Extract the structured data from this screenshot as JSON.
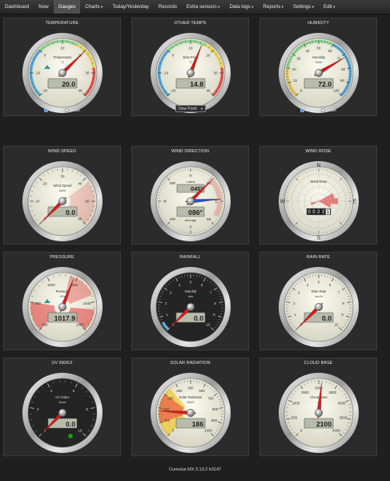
{
  "nav": {
    "items": [
      {
        "label": "Dashboard",
        "caret": ""
      },
      {
        "label": "Now",
        "caret": ""
      },
      {
        "label": "Gauges",
        "caret": ""
      },
      {
        "label": "Charts",
        "caret": "▾"
      },
      {
        "label": "Today/Yesterday",
        "caret": ""
      },
      {
        "label": "Records",
        "caret": ""
      },
      {
        "label": "Extra sensors",
        "caret": "▾"
      },
      {
        "label": "Data logs",
        "caret": "▾"
      },
      {
        "label": "Reports",
        "caret": "▾"
      },
      {
        "label": "Settings",
        "caret": "▾"
      },
      {
        "label": "Edit",
        "caret": "▾"
      }
    ],
    "active_index": 2
  },
  "panels": {
    "temperature": {
      "title": "TEMPERATURE",
      "name": "Temperature",
      "unit": "°C",
      "value": "20.0",
      "ticks": [
        "-20",
        "-10",
        "0",
        "10",
        "20",
        "30",
        "40"
      ],
      "radio": {
        "option1": "Outside",
        "option2": "Inside",
        "selected": "Outside"
      }
    },
    "other_temps": {
      "title": "OTHER TEMPS",
      "name": "Dew Point",
      "unit": "°C",
      "value": "14.8",
      "ticks": [
        "-20",
        "-10",
        "0",
        "10",
        "20",
        "30",
        "40"
      ],
      "select": "Dew Point"
    },
    "humidity": {
      "title": "HUMIDITY",
      "name": "Humidity",
      "unit": "%RH",
      "value": "72.0",
      "ticks": [
        "0",
        "10",
        "20",
        "30",
        "40",
        "50",
        "60",
        "70",
        "80",
        "90",
        "100"
      ],
      "radio": {
        "option1": "Outside",
        "option2": "Inside",
        "selected": "Outside"
      }
    },
    "wind_speed": {
      "title": "WIND SPEED",
      "name": "Wind Speed",
      "unit": "km/h",
      "value": "0.0",
      "ticks": [
        "0",
        "10",
        "20",
        "30",
        "40",
        "50",
        "60"
      ]
    },
    "wind_direction": {
      "title": "WIND DIRECTION",
      "latest_label": "Latest",
      "latest": "045°",
      "average_label": "Average",
      "average": "086°",
      "compass": [
        "N",
        "NE",
        "E",
        "SE",
        "S",
        "SW",
        "W",
        "NW"
      ]
    },
    "wind_rose": {
      "title": "WIND ROSE",
      "name": "Wind Rose",
      "odometer": "00221",
      "compass": [
        "N",
        "E",
        "S",
        "W"
      ]
    },
    "pressure": {
      "title": "PRESSURE",
      "name": "Pressure",
      "unit": "hPa",
      "value": "1017.9",
      "ticks": [
        "960",
        "980",
        "1000",
        "1020",
        "1040",
        "1060"
      ]
    },
    "rainfall": {
      "title": "RAINFALL",
      "name": "Rainfall",
      "unit": "mm",
      "value": "0.0",
      "ticks": [
        "0",
        "1",
        "2",
        "3",
        "4",
        "5",
        "6",
        "7",
        "8",
        "9",
        "10"
      ]
    },
    "rain_rate": {
      "title": "RAIN RATE",
      "name": "Rain Rate",
      "unit": "mm/h",
      "value": "0.0",
      "ticks": [
        "0",
        "1",
        "2",
        "3",
        "4",
        "5",
        "6",
        "7",
        "8",
        "9",
        "10"
      ]
    },
    "uv_index": {
      "title": "UV INDEX",
      "name": "UV Index",
      "unit": "None",
      "value": "0.0",
      "ticks": [
        "0",
        "2",
        "4",
        "6",
        "8",
        "10"
      ]
    },
    "solar_radiation": {
      "title": "SOLAR RADIATION",
      "name": "Solar Radiation",
      "unit": "W/m²",
      "value": "186",
      "ticks": [
        "0",
        "100",
        "200",
        "300",
        "400",
        "500",
        "600",
        "700",
        "800",
        "900",
        "1000"
      ]
    },
    "cloud_base": {
      "title": "CLOUD BASE",
      "name": "Cloud Base",
      "unit": "m",
      "value": "2100",
      "ticks": [
        "0",
        "500",
        "1000",
        "1500",
        "2000",
        "2500",
        "3000",
        "3500",
        "4000"
      ]
    }
  },
  "footer": {
    "text": "Cumulus MX 3.13.2 b3147"
  },
  "colors": {
    "page_bg": "#1f1f1f",
    "panel_bg": "#2b2b2b",
    "accent_blue": "#2a7fff",
    "needle_red": "#cc2020"
  }
}
